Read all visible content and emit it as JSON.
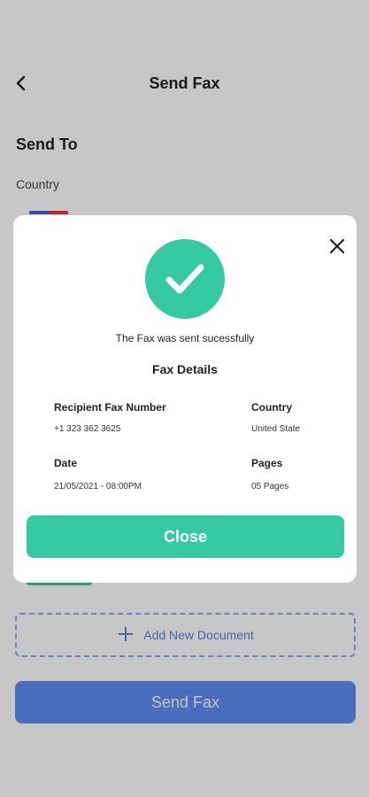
{
  "header": {
    "title": "Send Fax",
    "back_icon": "chevron-left-icon"
  },
  "form": {
    "section_title": "Send To",
    "country_label": "Country",
    "add_document_label": "Add New Document",
    "add_icon": "plus-icon",
    "send_button_label": "Send Fax"
  },
  "modal": {
    "close_icon": "close-icon",
    "success_icon": "checkmark-icon",
    "success_message": "The Fax was sent sucessfully",
    "details_title": "Fax Details",
    "details": {
      "recipient_label": "Recipient Fax Number",
      "recipient_value": "+1 323 362 3625",
      "country_label": "Country",
      "country_value": "United State",
      "date_label": "Date",
      "date_value": "21/05/2021 - 08:00PM",
      "pages_label": "Pages",
      "pages_value": "05 Pages"
    },
    "close_button_label": "Close"
  },
  "colors": {
    "accent_green": "#35c9a0",
    "accent_blue": "#5e8bf2",
    "overlay": "rgba(0,0,0,0.22)"
  }
}
